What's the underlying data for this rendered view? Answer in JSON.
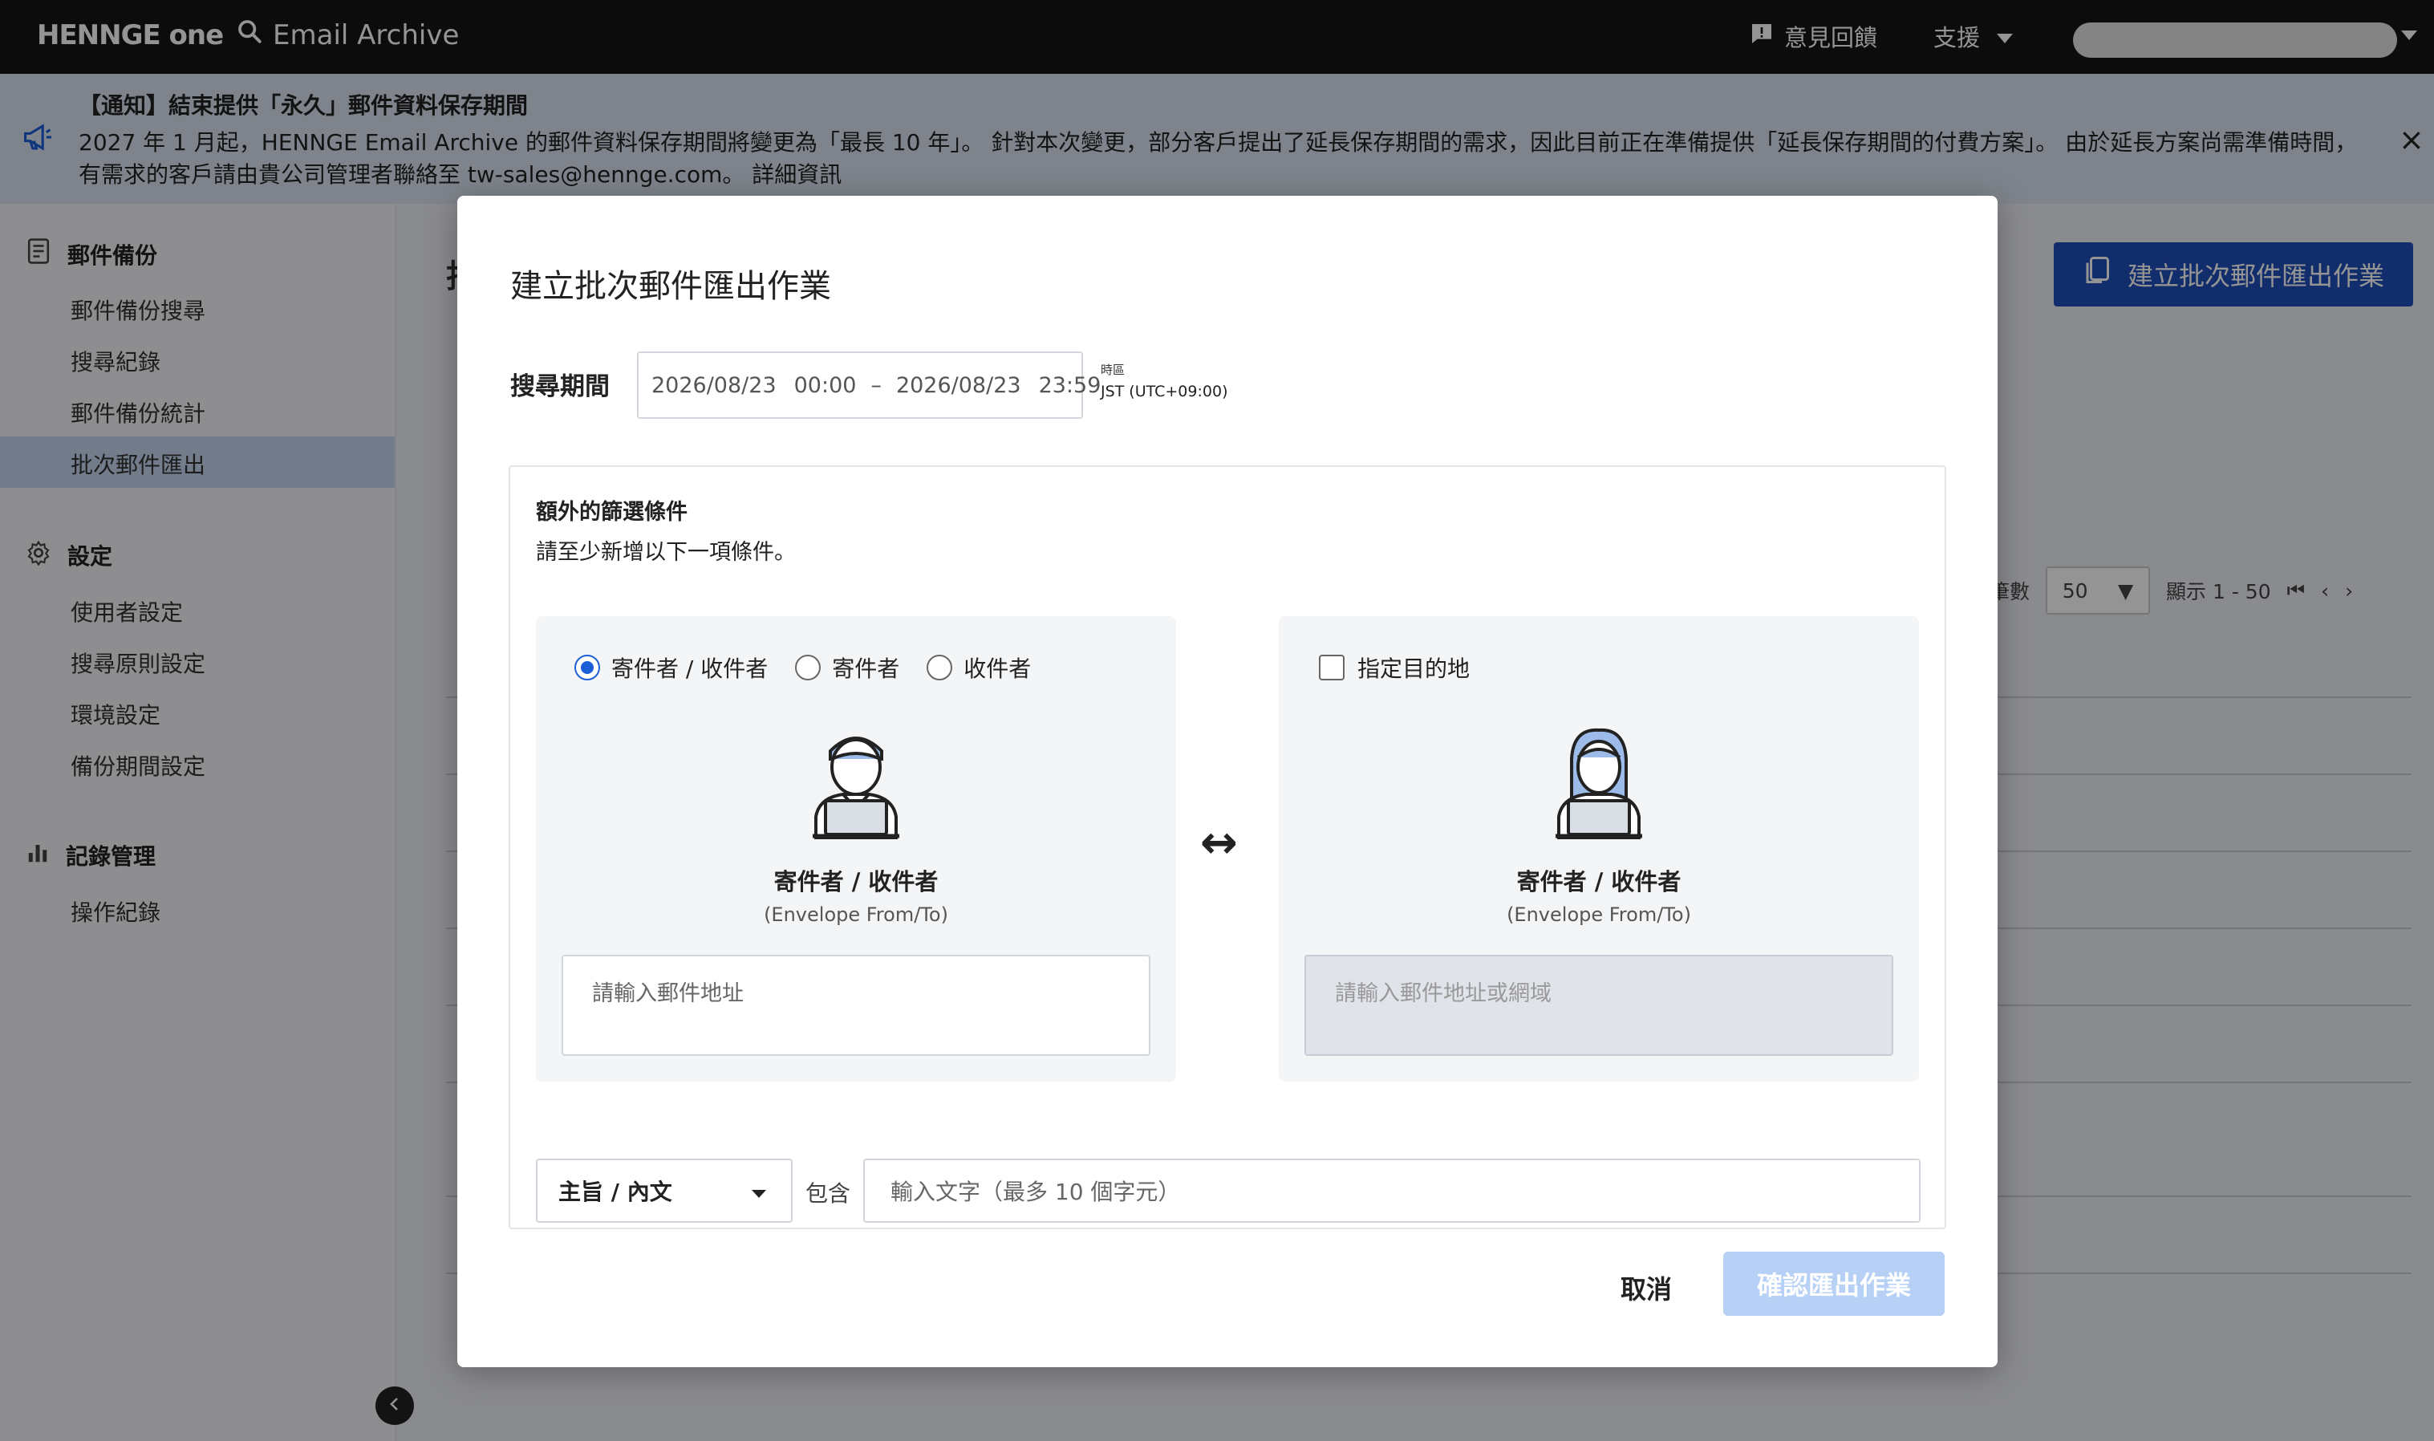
{
  "header": {
    "brand": "HENNGE one",
    "app_title": "Email Archive",
    "feedback_label": "意見回饋",
    "support_label": "支援"
  },
  "notice": {
    "title": "【通知】結束提供「永久」郵件資料保存期間",
    "body": "2027 年 1 月起，HENNGE Email Archive 的郵件資料保存期間將變更為「最長 10 年」。 針對本次變更，部分客戶提出了延長保存期間的需求，因此目前正在準備提供「延長保存期間的付費方案」。 由於延長方案尚需準備時間，有需求的客戶請由貴公司管理者聯絡至 tw-sales@hennge.com。 詳細資訊"
  },
  "sidebar": {
    "groups": [
      {
        "label": "郵件備份",
        "icon": "document-icon",
        "items": [
          "郵件備份搜尋",
          "搜尋紀錄",
          "郵件備份統計",
          "批次郵件匯出"
        ]
      },
      {
        "label": "設定",
        "icon": "gear-icon",
        "items": [
          "使用者設定",
          "搜尋原則設定",
          "環境設定",
          "備份期間設定"
        ]
      },
      {
        "label": "記錄管理",
        "icon": "bar-chart-icon",
        "items": [
          "操作紀錄"
        ]
      }
    ],
    "active_item": "批次郵件匯出"
  },
  "background": {
    "create_button": "建立批次郵件匯出作業",
    "per_page_label": "筆數",
    "per_page_value": "50",
    "range_label": "顯示 1 - 50"
  },
  "modal": {
    "title": "建立批次郵件匯出作業",
    "period_label": "搜尋期間",
    "start_date": "2026/08/23",
    "start_time": "00:00",
    "dash": "–",
    "end_date": "2026/08/23",
    "end_time": "23:59",
    "timezone_label": "時區",
    "timezone_value": "JST (UTC+09:00)",
    "filters_title": "額外的篩選條件",
    "filters_sub": "請至少新增以下一項條件。",
    "left": {
      "radios": [
        {
          "label": "寄件者 / 收件者",
          "selected": true
        },
        {
          "label": "寄件者",
          "selected": false
        },
        {
          "label": "收件者",
          "selected": false
        }
      ],
      "label": "寄件者 / 收件者",
      "sub": "(Envelope From/To)",
      "placeholder": "請輸入郵件地址"
    },
    "swap_symbol": "↔",
    "right": {
      "checkbox_label": "指定目的地",
      "checked": false,
      "label": "寄件者 / 收件者",
      "sub": "(Envelope From/To)",
      "placeholder": "請輸入郵件地址或網域"
    },
    "field_select": "主旨 / 內文",
    "contains_label": "包含",
    "keyword_placeholder": "輸入文字（最多 10 個字元）",
    "cancel_label": "取消",
    "confirm_label": "確認匯出作業"
  }
}
